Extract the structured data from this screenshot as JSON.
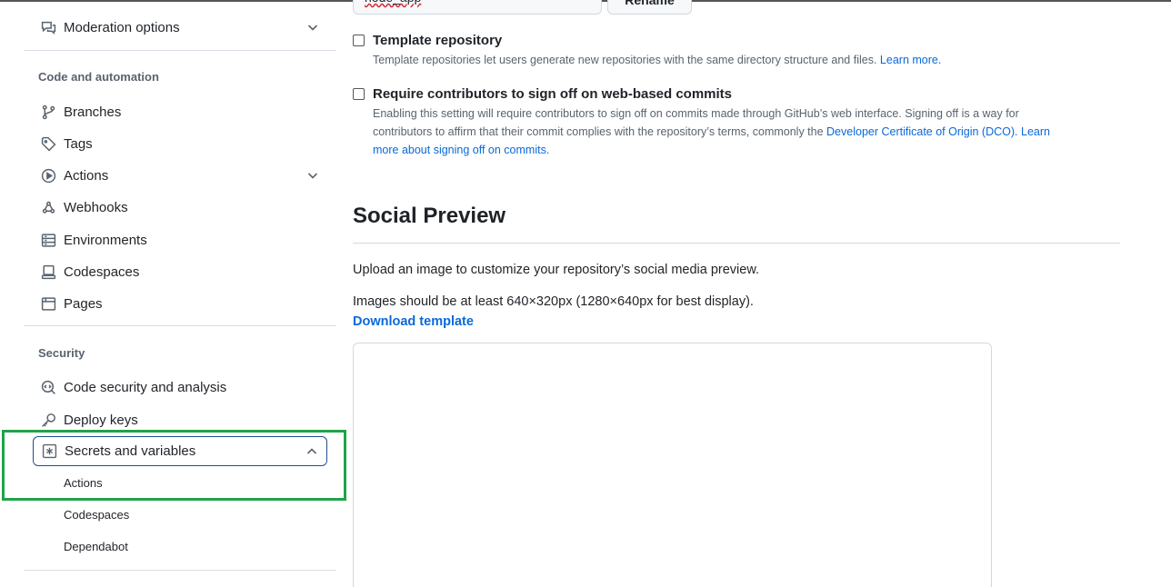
{
  "sidebar": {
    "moderation": {
      "label": "Moderation options",
      "icon": "comment-discussion-icon"
    },
    "code_automation_title": "Code and automation",
    "items": [
      {
        "label": "Branches",
        "icon": "git-branch-icon"
      },
      {
        "label": "Tags",
        "icon": "tag-icon"
      },
      {
        "label": "Actions",
        "icon": "play-icon"
      },
      {
        "label": "Webhooks",
        "icon": "webhook-icon"
      },
      {
        "label": "Environments",
        "icon": "server-icon"
      },
      {
        "label": "Codespaces",
        "icon": "codespaces-icon"
      },
      {
        "label": "Pages",
        "icon": "browser-icon"
      }
    ],
    "security_title": "Security",
    "security_items": [
      {
        "label": "Code security and analysis",
        "icon": "codescan-icon"
      },
      {
        "label": "Deploy keys",
        "icon": "key-icon"
      },
      {
        "label": "Secrets and variables",
        "icon": "key-asterisk-icon"
      }
    ],
    "secrets_sub": [
      "Actions",
      "Codespaces",
      "Dependabot"
    ]
  },
  "main": {
    "repo_name": "node_app",
    "rename_label": "Rename",
    "template_repo": {
      "label": "Template repository",
      "desc": "Template repositories let users generate new repositories with the same directory structure and files.",
      "link": "Learn more."
    },
    "signoff": {
      "label": "Require contributors to sign off on web-based commits",
      "desc1": "Enabling this setting will require contributors to sign off on commits made through GitHub’s web interface. Signing off is a way for",
      "desc2": "contributors to affirm that their commit complies with the repository’s terms, commonly the",
      "link1": "Developer Certificate of Origin (DCO).",
      "link2a": "Learn",
      "link2b": "more about signing off on commits."
    },
    "social_title": "Social Preview",
    "social_p1": "Upload an image to customize your repository’s social media preview.",
    "social_p2": "Images should be at least 640×320px (1280×640px for best display).",
    "download_template": "Download template"
  },
  "colors": {
    "accent": "#0969da",
    "highlight": "#1fa34a",
    "active_border": "#1f4f8a"
  }
}
